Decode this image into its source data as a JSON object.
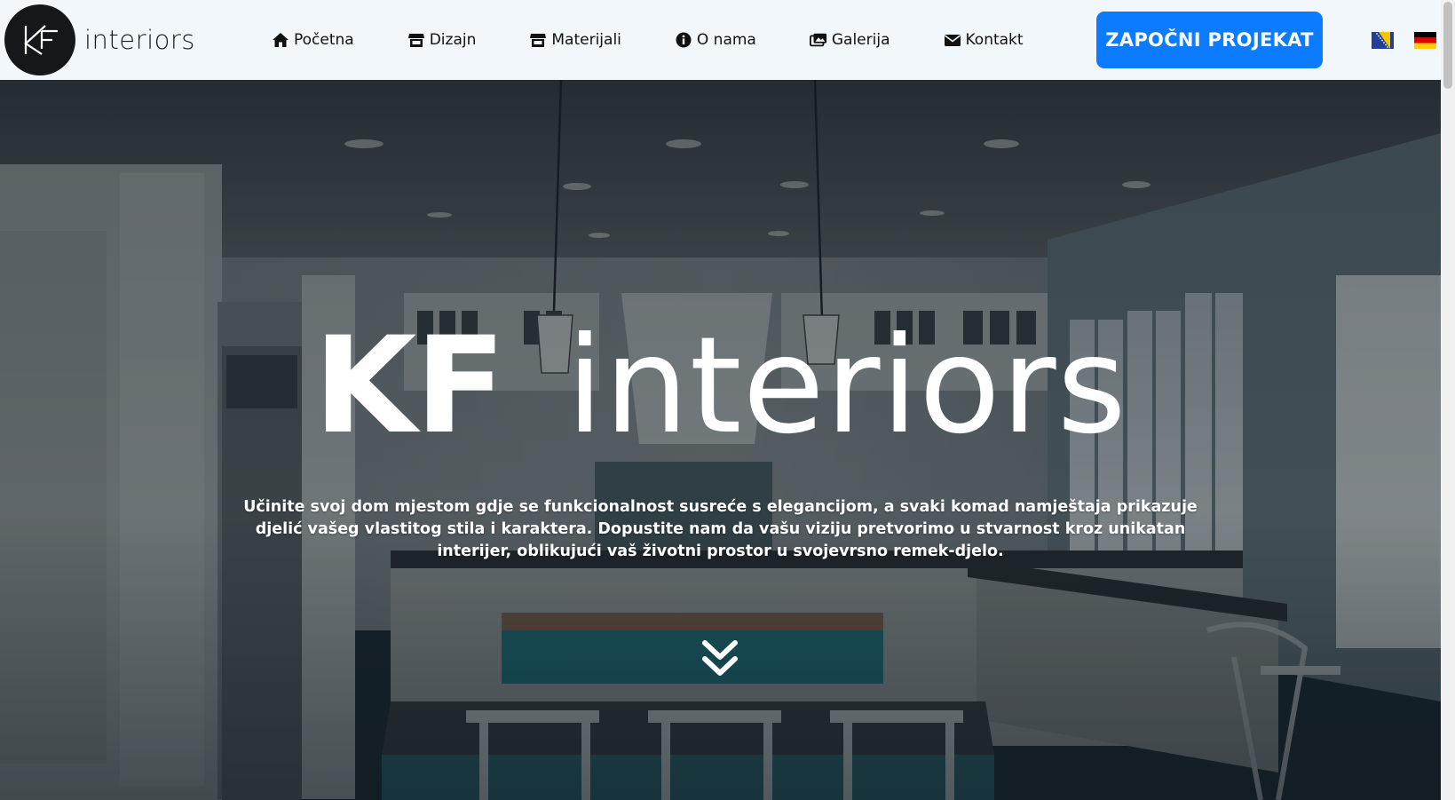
{
  "brand": {
    "logo_letters": "KF",
    "name": "interiors"
  },
  "nav": {
    "items": [
      {
        "label": "Početna",
        "icon": "home-icon"
      },
      {
        "label": "Dizajn",
        "icon": "store-icon"
      },
      {
        "label": "Materijali",
        "icon": "store-icon"
      },
      {
        "label": "O nama",
        "icon": "info-icon"
      },
      {
        "label": "Galerija",
        "icon": "images-icon"
      },
      {
        "label": "Kontakt",
        "icon": "envelope-icon"
      }
    ],
    "cta_label": "ZAPOČNI PROJEKAT",
    "languages": [
      {
        "code": "bs",
        "icon": "flag-bosnia-icon"
      },
      {
        "code": "de",
        "icon": "flag-germany-icon"
      }
    ]
  },
  "hero": {
    "title_part1": "KF",
    "title_part2": "interiors",
    "description": "Učinite svoj dom mjestom gdje se funkcionalnost susreće s elegancijom, a svaki komad namještaja prikazuje djelić vašeg vlastitog stila i karaktera. Dopustite nam da vašu viziju pretvorimo u stvarnost kroz unikatan interijer, oblikujući vaš životni prostor u svojevrsno remek-djelo.",
    "scroll_icon": "double-chevron-down-icon"
  },
  "colors": {
    "header_bg": "#f2f7fb",
    "cta_bg": "#0d7bff",
    "logo_circle": "#14181b",
    "hero_overlay": "#1c2a33"
  }
}
